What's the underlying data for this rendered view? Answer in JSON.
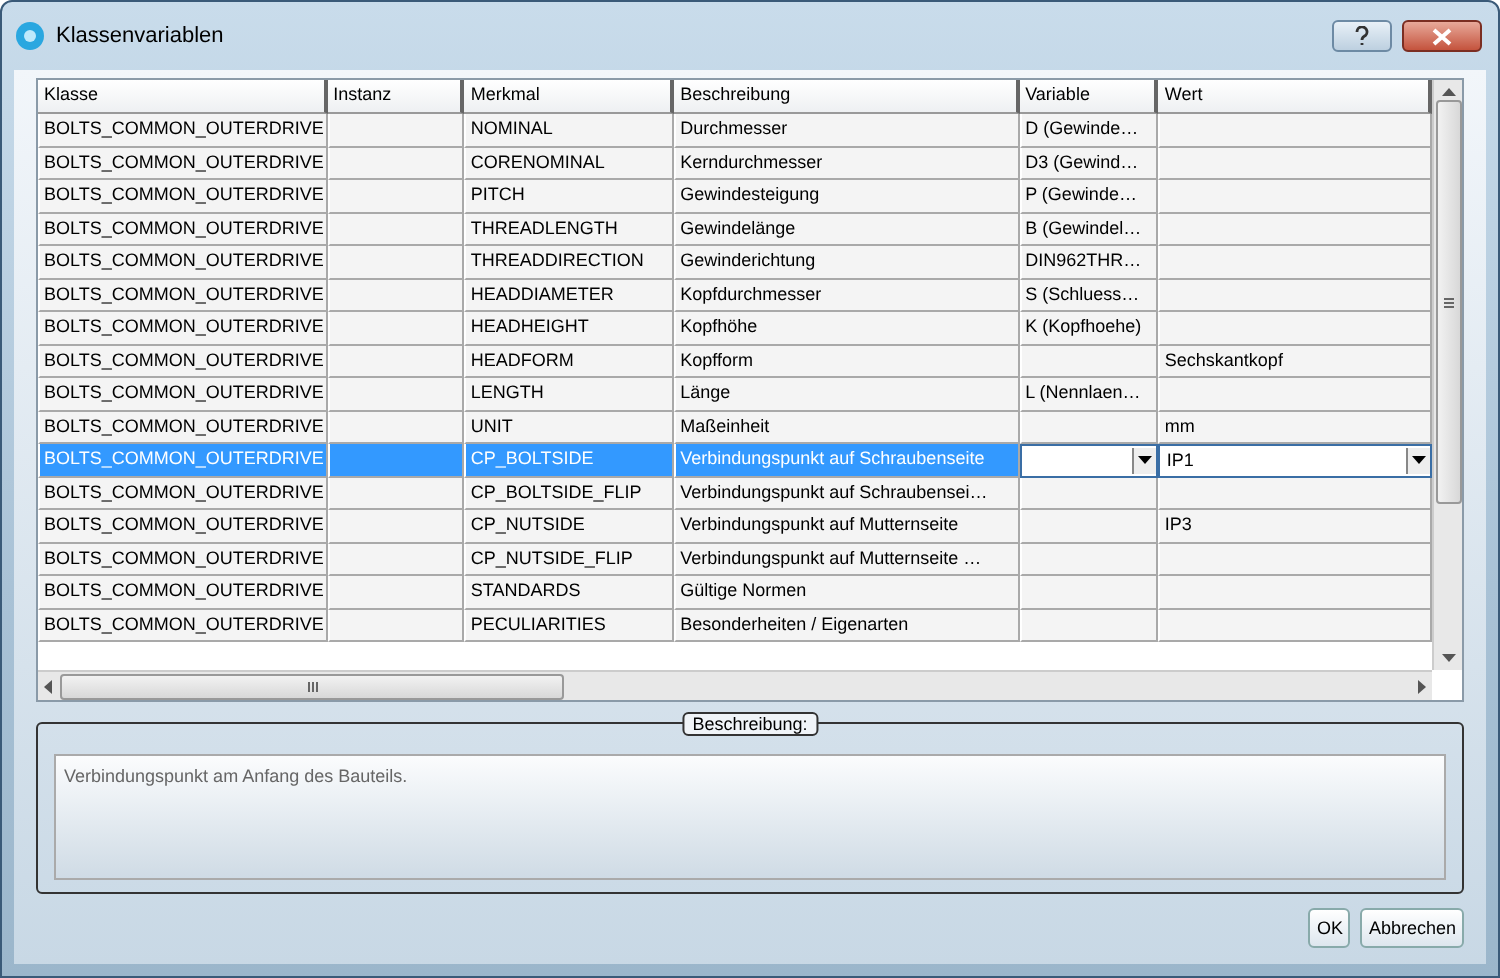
{
  "window": {
    "title": "Klassenvariablen"
  },
  "table": {
    "columns": [
      "Klasse",
      "Instanz",
      "Merkmal",
      "Beschreibung",
      "Variable",
      "Wert"
    ],
    "rows": [
      {
        "cells": [
          "BOLTS_COMMON_OUTERDRIVE",
          "",
          "NOMINAL",
          "Durchmesser",
          "D (Gewinde…",
          ""
        ],
        "selected": false
      },
      {
        "cells": [
          "BOLTS_COMMON_OUTERDRIVE",
          "",
          "CORENOMINAL",
          "Kerndurchmesser",
          "D3 (Gewind…",
          ""
        ],
        "selected": false
      },
      {
        "cells": [
          "BOLTS_COMMON_OUTERDRIVE",
          "",
          "PITCH",
          "Gewindesteigung",
          "P (Gewinde…",
          ""
        ],
        "selected": false
      },
      {
        "cells": [
          "BOLTS_COMMON_OUTERDRIVE",
          "",
          "THREADLENGTH",
          "Gewindelänge",
          "B (Gewindel…",
          ""
        ],
        "selected": false
      },
      {
        "cells": [
          "BOLTS_COMMON_OUTERDRIVE",
          "",
          "THREADDIRECTION",
          "Gewinderichtung",
          "DIN962THR…",
          ""
        ],
        "selected": false
      },
      {
        "cells": [
          "BOLTS_COMMON_OUTERDRIVE",
          "",
          "HEADDIAMETER",
          "Kopfdurchmesser",
          "S (Schluess…",
          ""
        ],
        "selected": false
      },
      {
        "cells": [
          "BOLTS_COMMON_OUTERDRIVE",
          "",
          "HEADHEIGHT",
          "Kopfhöhe",
          "K (Kopfhoehe)",
          ""
        ],
        "selected": false
      },
      {
        "cells": [
          "BOLTS_COMMON_OUTERDRIVE",
          "",
          "HEADFORM",
          "Kopfform",
          "",
          "Sechskantkopf"
        ],
        "selected": false
      },
      {
        "cells": [
          "BOLTS_COMMON_OUTERDRIVE",
          "",
          "LENGTH",
          "Länge",
          "L (Nennlaen…",
          ""
        ],
        "selected": false
      },
      {
        "cells": [
          "BOLTS_COMMON_OUTERDRIVE",
          "",
          "UNIT",
          "Maßeinheit",
          "",
          "mm"
        ],
        "selected": false
      },
      {
        "cells": [
          "BOLTS_COMMON_OUTERDRIVE",
          "",
          "CP_BOLTSIDE",
          "Verbindungspunkt auf Schraubenseite",
          "",
          "IP1"
        ],
        "selected": true
      },
      {
        "cells": [
          "BOLTS_COMMON_OUTERDRIVE",
          "",
          "CP_BOLTSIDE_FLIP",
          "Verbindungspunkt auf Schraubensei…",
          "",
          ""
        ],
        "selected": false
      },
      {
        "cells": [
          "BOLTS_COMMON_OUTERDRIVE",
          "",
          "CP_NUTSIDE",
          "Verbindungspunkt auf Mutternseite",
          "",
          "IP3"
        ],
        "selected": false
      },
      {
        "cells": [
          "BOLTS_COMMON_OUTERDRIVE",
          "",
          "CP_NUTSIDE_FLIP",
          "Verbindungspunkt auf Mutternseite …",
          "",
          ""
        ],
        "selected": false
      },
      {
        "cells": [
          "BOLTS_COMMON_OUTERDRIVE",
          "",
          "STANDARDS",
          "Gültige Normen",
          "",
          ""
        ],
        "selected": false
      },
      {
        "cells": [
          "BOLTS_COMMON_OUTERDRIVE",
          "",
          "PECULIARITIES",
          "Besonderheiten / Eigenarten",
          "",
          ""
        ],
        "selected": false
      }
    ]
  },
  "description": {
    "legend": "Beschreibung:",
    "text": "Verbindungspunkt am Anfang des Bauteils."
  },
  "buttons": [
    "OK",
    "Abbrechen"
  ]
}
